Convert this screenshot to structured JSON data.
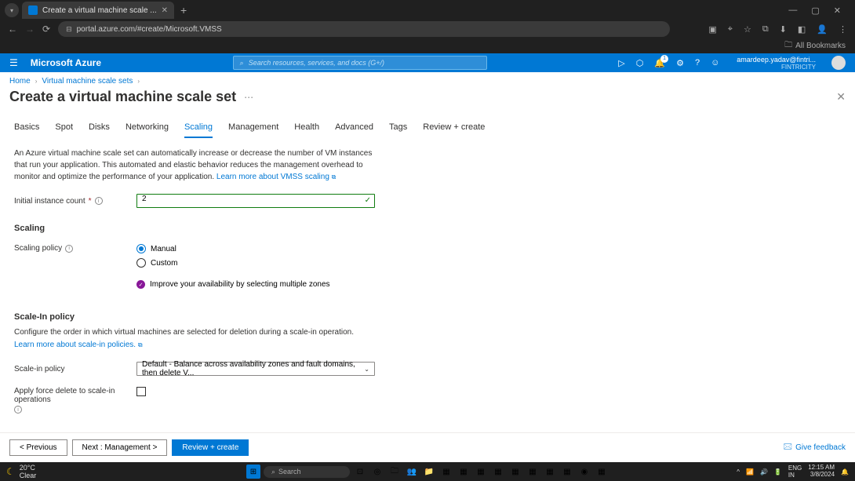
{
  "browser": {
    "tab_title": "Create a virtual machine scale ...",
    "url": "portal.azure.com/#create/Microsoft.VMSS",
    "bookmarks_label": "All Bookmarks"
  },
  "azure_header": {
    "brand": "Microsoft Azure",
    "search_placeholder": "Search resources, services, and docs (G+/)",
    "user_email": "amardeep.yadav@fintri...",
    "user_tenant": "FINTRICITY"
  },
  "breadcrumb": {
    "home": "Home",
    "vmss": "Virtual machine scale sets"
  },
  "page": {
    "title": "Create a virtual machine scale set"
  },
  "tabs": {
    "basics": "Basics",
    "spot": "Spot",
    "disks": "Disks",
    "networking": "Networking",
    "scaling": "Scaling",
    "management": "Management",
    "health": "Health",
    "advanced": "Advanced",
    "tags": "Tags",
    "review": "Review + create"
  },
  "scaling": {
    "description": "An Azure virtual machine scale set can automatically increase or decrease the number of VM instances that run your application. This automated and elastic behavior reduces the management overhead to monitor and optimize the performance of your application.",
    "learn_more": "Learn more about VMSS scaling",
    "initial_count_label": "Initial instance count",
    "initial_count_value": "2",
    "section_title": "Scaling",
    "policy_label": "Scaling policy",
    "policy_manual": "Manual",
    "policy_custom": "Custom",
    "zones_hint": "Improve your availability by selecting multiple zones"
  },
  "scalein": {
    "section_title": "Scale-In policy",
    "description": "Configure the order in which virtual machines are selected for deletion during a scale-in operation.",
    "learn_more": "Learn more about scale-in policies.",
    "policy_label": "Scale-in policy",
    "policy_value": "Default - Balance across availability zones and fault domains, then delete V...",
    "force_delete_label": "Apply force delete to scale-in operations"
  },
  "footer": {
    "previous": "< Previous",
    "next": "Next : Management >",
    "review": "Review + create",
    "feedback": "Give feedback"
  },
  "taskbar": {
    "weather_temp": "20°C",
    "weather_desc": "Clear",
    "search": "Search",
    "lang1": "ENG",
    "lang2": "IN",
    "time": "12:15 AM",
    "date": "3/8/2024"
  }
}
